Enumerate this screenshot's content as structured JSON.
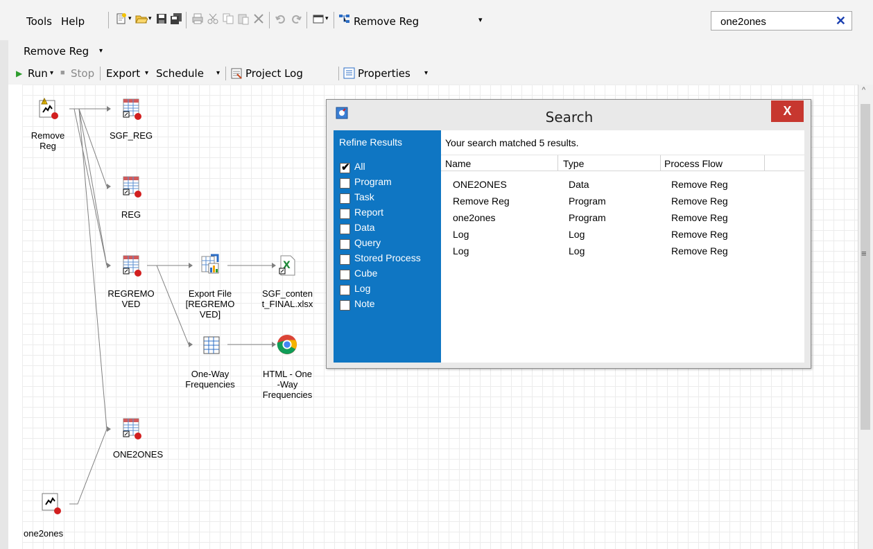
{
  "menubar": {
    "items": [
      "Tools",
      "Help"
    ],
    "program_label": "Remove Reg",
    "search_value": "one2ones"
  },
  "tab": {
    "label": "Remove Reg"
  },
  "flow_toolbar": {
    "run": "Run",
    "stop": "Stop",
    "export": "Export",
    "schedule": "Schedule",
    "project_log": "Project Log",
    "properties": "Properties"
  },
  "nodes": {
    "remove_reg": "Remove\nReg",
    "sgf_reg": "SGF_REG",
    "reg": "REG",
    "regremoved": "REGREMO\nVED",
    "export_file": "Export File\n[REGREMO\nVED]",
    "sgf_content": "SGF_conten\nt_FINAL.xlsx",
    "one_way": "One-Way\nFrequencies",
    "html_one_way": "HTML - One\n-Way\nFrequencies",
    "one2ones_data": "ONE2ONES",
    "one2ones_prog": "one2ones"
  },
  "dialog": {
    "title": "Search",
    "close": "X",
    "refine_title": "Refine Results",
    "filters": [
      {
        "label": "All",
        "checked": true
      },
      {
        "label": "Program",
        "checked": false
      },
      {
        "label": "Task",
        "checked": false
      },
      {
        "label": "Report",
        "checked": false
      },
      {
        "label": "Data",
        "checked": false
      },
      {
        "label": "Query",
        "checked": false
      },
      {
        "label": "Stored Process",
        "checked": false
      },
      {
        "label": "Cube",
        "checked": false
      },
      {
        "label": "Log",
        "checked": false
      },
      {
        "label": "Note",
        "checked": false
      }
    ],
    "summary": "Your search matched 5 results.",
    "columns": [
      "Name",
      "Type",
      "Process Flow"
    ],
    "rows": [
      [
        "ONE2ONES",
        "Data",
        "Remove Reg"
      ],
      [
        "Remove Reg",
        "Program",
        "Remove Reg"
      ],
      [
        "one2ones",
        "Program",
        "Remove Reg"
      ],
      [
        "Log",
        "Log",
        "Remove Reg"
      ],
      [
        "Log",
        "Log",
        "Remove Reg"
      ]
    ]
  },
  "colors": {
    "refine_bg": "#0f76c3",
    "close_bg": "#c7372f",
    "clear_x": "#1a3fb0"
  }
}
